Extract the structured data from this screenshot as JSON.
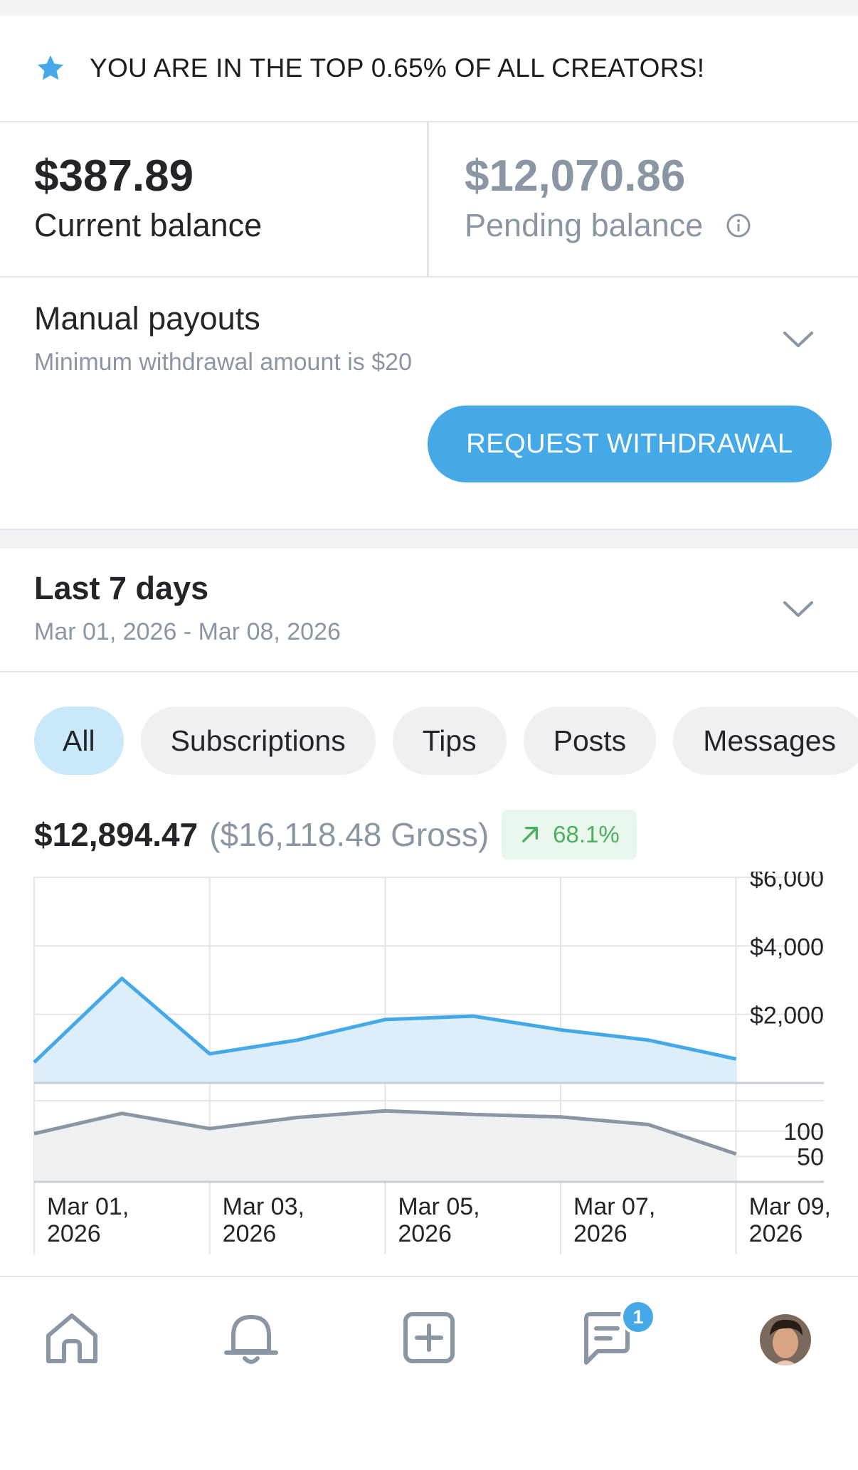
{
  "banner": {
    "text": "YOU ARE IN THE TOP 0.65% OF ALL CREATORS!",
    "icon": "star-icon",
    "icon_color": "#45a9e8"
  },
  "balances": {
    "current": {
      "amount": "$387.89",
      "label": "Current balance"
    },
    "pending": {
      "amount": "$12,070.86",
      "label": "Pending balance",
      "icon": "info-icon"
    }
  },
  "payouts": {
    "title": "Manual payouts",
    "subtitle": "Minimum withdrawal amount is $20",
    "button": "REQUEST WITHDRAWAL"
  },
  "period": {
    "title": "Last 7 days",
    "range": "Mar 01, 2026 - Mar 08, 2026"
  },
  "filters": {
    "selected": "All",
    "chips": [
      "All",
      "Subscriptions",
      "Tips",
      "Posts",
      "Messages"
    ]
  },
  "summary": {
    "net": "$12,894.47",
    "gross": "($16,118.48 Gross)",
    "trend": "68.1%",
    "trend_direction": "up"
  },
  "chart_data": [
    {
      "type": "area",
      "x": [
        "2026-03-01",
        "2026-03-02",
        "2026-03-03",
        "2026-03-04",
        "2026-03-05",
        "2026-03-06",
        "2026-03-07",
        "2026-03-08",
        "2026-03-09"
      ],
      "series": [
        {
          "values": [
            600,
            3050,
            850,
            1250,
            1850,
            1950,
            1550,
            1250,
            700
          ]
        }
      ],
      "ylim": [
        0,
        6000
      ],
      "yticks": [
        "$6,000",
        "$4,000",
        "$2,000"
      ],
      "color": "#45a9e8",
      "grid": true
    },
    {
      "type": "area",
      "x": [
        "2026-03-01",
        "2026-03-02",
        "2026-03-03",
        "2026-03-04",
        "2026-03-05",
        "2026-03-06",
        "2026-03-07",
        "2026-03-08",
        "2026-03-09"
      ],
      "series": [
        {
          "values": [
            95,
            135,
            105,
            127,
            140,
            133,
            128,
            113,
            55
          ]
        }
      ],
      "yticks": [
        "100",
        "50"
      ],
      "color": "#8a96a3",
      "grid": true
    }
  ],
  "chart_axis": {
    "x_tick_lines": [
      [
        "Mar 01,",
        "2026"
      ],
      [
        "Mar 03,",
        "2026"
      ],
      [
        "Mar 05,",
        "2026"
      ],
      [
        "Mar 07,",
        "2026"
      ],
      [
        "Mar 09,",
        "2026"
      ]
    ]
  },
  "nav": {
    "items": [
      "home-icon",
      "bell-icon",
      "add-post-icon",
      "messages-icon",
      "avatar"
    ],
    "messages_badge": "1"
  }
}
